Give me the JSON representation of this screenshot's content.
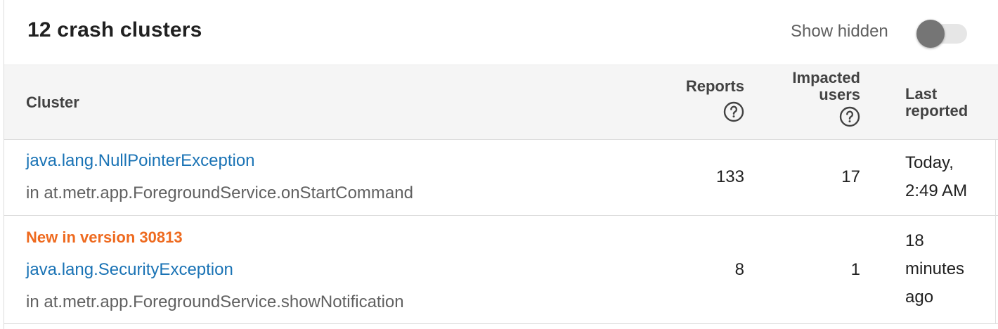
{
  "header": {
    "title": "12 crash clusters",
    "show_hidden_label": "Show hidden",
    "show_hidden_on": false
  },
  "table": {
    "columns": {
      "cluster": "Cluster",
      "reports": "Reports",
      "impacted_users": [
        "Impacted",
        "users"
      ],
      "last_reported": [
        "Last",
        "reported"
      ]
    },
    "rows": [
      {
        "badge": "",
        "exception": "java.lang.NullPointerException",
        "location": "in at.metr.app.ForegroundService.onStartCommand",
        "reports": "133",
        "users": "17",
        "last_reported": [
          "Today,",
          "2:49 AM"
        ]
      },
      {
        "badge": "New in version 30813",
        "exception": "java.lang.SecurityException",
        "location": "in at.metr.app.ForegroundService.showNotification",
        "reports": "8",
        "users": "1",
        "last_reported": [
          "18",
          "minutes",
          "ago"
        ]
      }
    ]
  },
  "colors": {
    "link": "#1a73b5",
    "new_badge": "#ee6a1f",
    "header_bg": "#f5f5f5"
  },
  "icons": {
    "help": "help-circle-icon"
  }
}
